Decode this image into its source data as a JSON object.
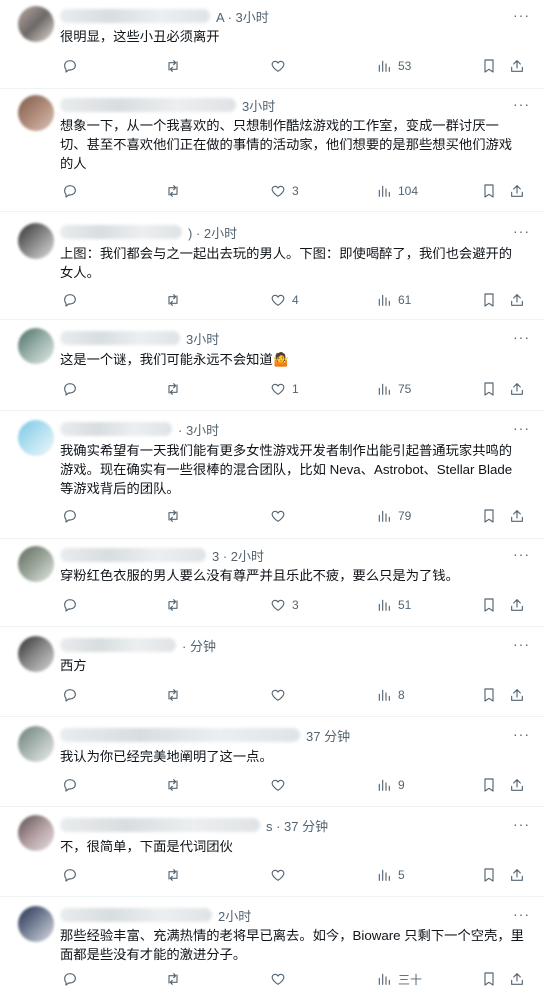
{
  "replies": [
    {
      "time": "A · 3小时",
      "text": "很明显，这些小丑必须离开",
      "likes": "",
      "views": "53"
    },
    {
      "time": "3小时",
      "text": "想象一下，从一个我喜欢的、只想制作酷炫游戏的工作室，变成一群讨厌一切、甚至不喜欢他们正在做的事情的活动家，他们想要的是那些想买他们游戏的人",
      "likes": "3",
      "views": "104"
    },
    {
      "time": ") · 2小时",
      "text": "上图：我们都会与之一起出去玩的男人。下图：即使喝醉了，我们也会避开的女人。",
      "likes": "4",
      "views": "61"
    },
    {
      "time": "3小时",
      "text": "这是一个谜，我们可能永远不会知道🤷",
      "likes": "1",
      "views": "75"
    },
    {
      "time": "· 3小时",
      "text": "我确实希望有一天我们能有更多女性游戏开发者制作出能引起普通玩家共鸣的游戏。现在确实有一些很棒的混合团队，比如 Neva、Astrobot、Stellar Blade 等游戏背后的团队。",
      "likes": "",
      "views": "79"
    },
    {
      "time": "3 · 2小时",
      "text": "穿粉红色衣服的男人要么没有尊严并且乐此不疲，要么只是为了钱。",
      "likes": "3",
      "views": "51"
    },
    {
      "time": "· 分钟",
      "text": "西方",
      "likes": "",
      "views": "8"
    },
    {
      "time": "37 分钟",
      "text": "我认为你已经完美地阐明了这一点。",
      "likes": "",
      "views": "9"
    },
    {
      "time": "s · 37 分钟",
      "text": "不，很简单，下面是代词团伙",
      "likes": "",
      "views": "5"
    },
    {
      "time": "2小时",
      "text": "那些经验丰富、充满热情的老将早已离去。如今，Bioware 只剩下一个空壳，里面都是些没有才能的激进分子。",
      "likes": "",
      "views": "三十"
    }
  ],
  "icons": {
    "more": "more-horizontal-icon",
    "reply": "reply-icon",
    "repost": "repost-icon",
    "like": "heart-icon",
    "views": "views-chart-icon",
    "bookmark": "bookmark-icon",
    "share": "share-icon"
  },
  "colors": {
    "muted": "#536471",
    "text": "#0f1419",
    "divider": "#eff3f4"
  }
}
